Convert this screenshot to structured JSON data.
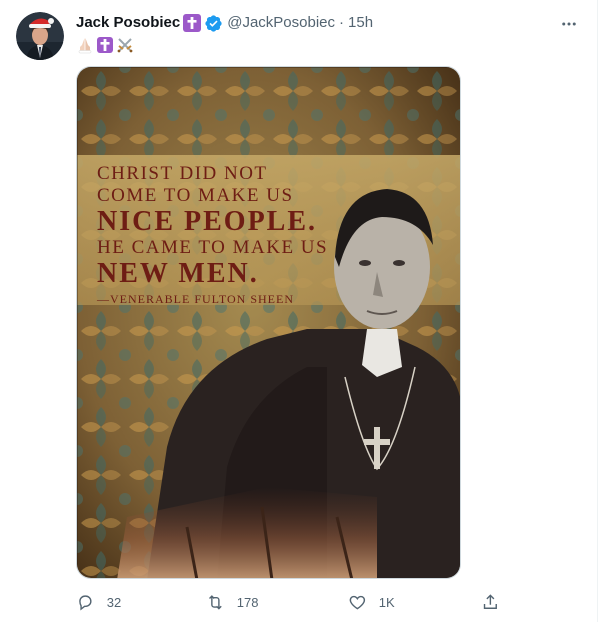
{
  "tweet": {
    "author_name": "Jack Posobiec",
    "handle": "@JackPosobiec",
    "separator": "·",
    "time": "15h",
    "bio_emojis": [
      "folded-hands-emoji",
      "latin-cross-emoji",
      "crossed-swords-emoji"
    ],
    "image": {
      "quote_lines": [
        "Christ did not",
        "come to make us",
        "nice people.",
        "He came to make us",
        "new men.",
        "—Venerable Fulton Sheen"
      ]
    },
    "actions": {
      "replies": "32",
      "retweets": "178",
      "likes": "1K"
    }
  },
  "colors": {
    "text_primary": "#0f1419",
    "text_secondary": "#536471",
    "verified_blue": "#1d9bf0",
    "cross_badge_purple": "#9c59c9",
    "quote_text": "#6e1d14"
  }
}
